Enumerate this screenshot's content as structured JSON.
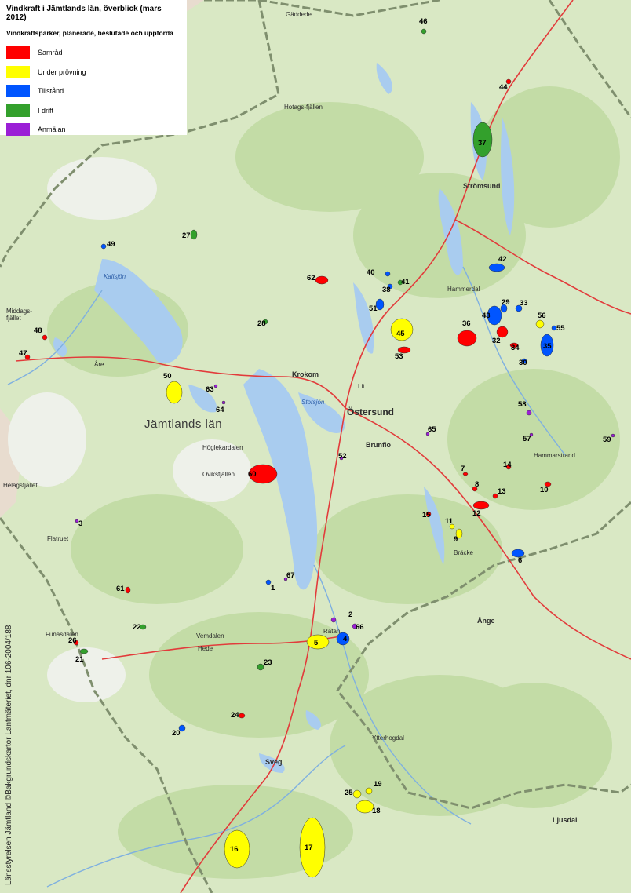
{
  "title": "Vindkraft i Jämtlands län, överblick (mars 2012)",
  "legend": {
    "subtitle": "Vindkraftsparker, planerade, beslutade och uppförda",
    "items": [
      {
        "label": "Samråd",
        "color": "#ff0000"
      },
      {
        "label": "Under prövning",
        "color": "#ffff00"
      },
      {
        "label": "Tillstånd",
        "color": "#0055ff"
      },
      {
        "label": "I drift",
        "color": "#33a02c"
      },
      {
        "label": "Anmälan",
        "color": "#9b1fd6"
      }
    ]
  },
  "credit": "Länsstyrelsen Jämtland ©Bakgrundskartor Lantmäteriet, dnr 106-2004/188",
  "colors": {
    "land": "#d9e8c4",
    "forest": "#c3dca6",
    "water": "#a9ccef",
    "border": "#7f8f6e",
    "road": "#e23b3b"
  },
  "places": {
    "region": "Jämtlands län",
    "ostersund": "Östersund",
    "stromsund": "Strömsund",
    "krokom": "Krokom",
    "brunflo": "Brunflo",
    "ange": "Ånge",
    "ljusdal": "Ljusdal",
    "sveg": "Sveg",
    "hammarstrand": "Hammarstrand",
    "storsjon": "Storsjön",
    "hotagsfjallen": "Hotags-fjällen",
    "ovikfjallen": "Oviksfjällen",
    "hoglekardalen": "Höglekardalen",
    "kallsjon": "Kallsjön",
    "middagsfjallet": "Middags-fjället",
    "helagsfjallet": "Helagsfjället",
    "flatruet": "Flatruet",
    "vemdalen": "Vemdalen",
    "hede": "Hede",
    "ratan": "Rätan",
    "bracke": "Bräcke",
    "lit": "Lit",
    "hammerdal": "Hammerdal",
    "gaddede": "Gäddede",
    "ytterhogdal": "Ytterhogdal",
    "funasdalen": "Funäsdalen",
    "are": "Åre"
  },
  "sites": [
    {
      "id": "1",
      "status": "Tillstånd"
    },
    {
      "id": "2",
      "status": "Anmälan"
    },
    {
      "id": "3",
      "status": "Anmälan"
    },
    {
      "id": "4",
      "status": "Tillstånd"
    },
    {
      "id": "5",
      "status": "Under prövning"
    },
    {
      "id": "6",
      "status": "Tillstånd"
    },
    {
      "id": "7",
      "status": "Samråd"
    },
    {
      "id": "8",
      "status": "Samråd"
    },
    {
      "id": "9",
      "status": "Under prövning"
    },
    {
      "id": "10",
      "status": "Samråd"
    },
    {
      "id": "11",
      "status": "Under prövning"
    },
    {
      "id": "12",
      "status": "Samråd"
    },
    {
      "id": "13",
      "status": "Samråd"
    },
    {
      "id": "14",
      "status": "Samråd"
    },
    {
      "id": "15",
      "status": "Samråd"
    },
    {
      "id": "16",
      "status": "Under prövning"
    },
    {
      "id": "17",
      "status": "Under prövning"
    },
    {
      "id": "18",
      "status": "Under prövning"
    },
    {
      "id": "19",
      "status": "Under prövning"
    },
    {
      "id": "20",
      "status": "Tillstånd"
    },
    {
      "id": "21",
      "status": "I drift"
    },
    {
      "id": "22",
      "status": "I drift"
    },
    {
      "id": "23",
      "status": "I drift"
    },
    {
      "id": "24",
      "status": "Samråd"
    },
    {
      "id": "25",
      "status": "Under prövning"
    },
    {
      "id": "26",
      "status": "Samråd"
    },
    {
      "id": "27",
      "status": "I drift"
    },
    {
      "id": "28",
      "status": "I drift"
    },
    {
      "id": "29",
      "status": "Tillstånd"
    },
    {
      "id": "30",
      "status": "Tillstånd"
    },
    {
      "id": "32",
      "status": "Samråd"
    },
    {
      "id": "33",
      "status": "Tillstånd"
    },
    {
      "id": "34",
      "status": "Samråd"
    },
    {
      "id": "35",
      "status": "Tillstånd"
    },
    {
      "id": "36",
      "status": "Samråd"
    },
    {
      "id": "37",
      "status": "I drift"
    },
    {
      "id": "38",
      "status": "Tillstånd"
    },
    {
      "id": "40",
      "status": "Tillstånd"
    },
    {
      "id": "41",
      "status": "I drift"
    },
    {
      "id": "42",
      "status": "Tillstånd"
    },
    {
      "id": "43",
      "status": "Tillstånd"
    },
    {
      "id": "44",
      "status": "Samråd"
    },
    {
      "id": "45",
      "status": "Under prövning"
    },
    {
      "id": "46",
      "status": "I drift"
    },
    {
      "id": "47",
      "status": "Samråd"
    },
    {
      "id": "48",
      "status": "Samråd"
    },
    {
      "id": "49",
      "status": "Tillstånd"
    },
    {
      "id": "50",
      "status": "Under prövning"
    },
    {
      "id": "51",
      "status": "Tillstånd"
    },
    {
      "id": "52",
      "status": "Anmälan"
    },
    {
      "id": "53",
      "status": "Samråd"
    },
    {
      "id": "55",
      "status": "Tillstånd"
    },
    {
      "id": "56",
      "status": "Under prövning"
    },
    {
      "id": "57",
      "status": "Anmälan"
    },
    {
      "id": "58",
      "status": "Anmälan"
    },
    {
      "id": "59",
      "status": "Anmälan"
    },
    {
      "id": "60",
      "status": "Samråd"
    },
    {
      "id": "61",
      "status": "Samråd"
    },
    {
      "id": "62",
      "status": "Samråd"
    },
    {
      "id": "63",
      "status": "Anmälan"
    },
    {
      "id": "64",
      "status": "Anmälan"
    },
    {
      "id": "65",
      "status": "Anmälan"
    },
    {
      "id": "66",
      "status": "Anmälan"
    },
    {
      "id": "67",
      "status": "Anmälan"
    }
  ]
}
